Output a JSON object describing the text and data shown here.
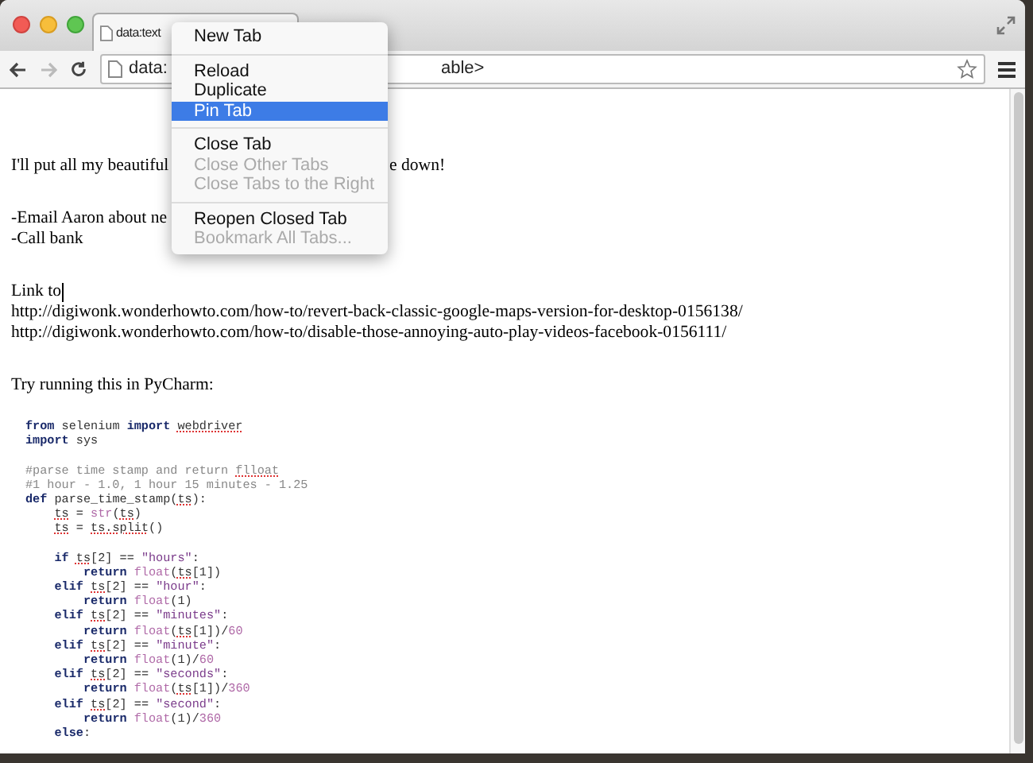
{
  "tab": {
    "title": "data:text"
  },
  "address_bar": {
    "parts": [
      "data:",
      "able>"
    ]
  },
  "page": {
    "lines": [
      {
        "kind": "text",
        "parts": [
          "I'll put all my beautiful",
          "e down!"
        ],
        "gap_before": true
      },
      {
        "kind": "text",
        "parts": [
          "-Email Aaron about ne"
        ],
        "gap_before": true
      },
      {
        "kind": "text",
        "parts": [
          "-Call bank"
        ],
        "gap_before": false
      },
      {
        "kind": "text",
        "parts": [
          "Link to"
        ],
        "gap_before": true,
        "caret": true
      },
      {
        "kind": "text",
        "parts": [
          "http://digiwonk.wonderhowto.com/how-to/revert-back-classic-google-maps-version-for-desktop-0156138/"
        ],
        "gap_before": false
      },
      {
        "kind": "text",
        "parts": [
          "http://digiwonk.wonderhowto.com/how-to/disable-those-annoying-auto-play-videos-facebook-0156111/"
        ],
        "gap_before": false
      },
      {
        "kind": "text",
        "parts": [
          "Try running this in PyCharm:"
        ],
        "gap_before": true
      }
    ]
  },
  "code": [
    {
      "gap_before": false,
      "tokens": [
        {
          "kind": "keyword",
          "text": "from"
        },
        {
          "kind": "plain",
          "text": " selenium "
        },
        {
          "kind": "keyword",
          "text": "import "
        },
        {
          "kind": "flagged",
          "text": "webdriver"
        }
      ]
    },
    {
      "gap_before": false,
      "tokens": [
        {
          "kind": "keyword",
          "text": "import"
        },
        {
          "kind": "plain",
          "text": " sys"
        }
      ]
    },
    {
      "gap_before": true,
      "tokens": [
        {
          "kind": "comment",
          "text": "#parse time stamp and return "
        },
        {
          "kind": "flagged_comment",
          "text": "flloat"
        }
      ]
    },
    {
      "gap_before": false,
      "tokens": [
        {
          "kind": "comment",
          "text": "#1 hour - 1.0, 1 hour 15 minutes - 1.25"
        }
      ]
    },
    {
      "gap_before": false,
      "tokens": [
        {
          "kind": "keyword",
          "text": "def"
        },
        {
          "kind": "plain",
          "text": " parse_time_stamp("
        },
        {
          "kind": "flagged",
          "text": "ts"
        },
        {
          "kind": "plain",
          "text": "):"
        }
      ]
    },
    {
      "gap_before": false,
      "tokens": [
        {
          "kind": "flagged",
          "text": "    ts"
        },
        {
          "kind": "plain",
          "text": " = "
        },
        {
          "kind": "builtin",
          "text": "str"
        },
        {
          "kind": "plain",
          "text": "("
        },
        {
          "kind": "flagged",
          "text": "ts"
        },
        {
          "kind": "plain",
          "text": ")"
        }
      ]
    },
    {
      "gap_before": false,
      "tokens": [
        {
          "kind": "flagged",
          "text": "    ts"
        },
        {
          "kind": "plain",
          "text": " = "
        },
        {
          "kind": "flagged",
          "text": "ts.split"
        },
        {
          "kind": "plain",
          "text": "()"
        }
      ]
    },
    {
      "gap_before": true,
      "tokens": [
        {
          "kind": "keyword",
          "text": "    if "
        },
        {
          "kind": "flagged",
          "text": "ts"
        },
        {
          "kind": "plain",
          "text": "[2] == "
        },
        {
          "kind": "string",
          "text": "\"hours\""
        },
        {
          "kind": "plain",
          "text": ":"
        }
      ]
    },
    {
      "gap_before": false,
      "tokens": [
        {
          "kind": "keyword",
          "text": "        return "
        },
        {
          "kind": "builtin",
          "text": "float"
        },
        {
          "kind": "plain",
          "text": "("
        },
        {
          "kind": "flagged",
          "text": "ts"
        },
        {
          "kind": "plain",
          "text": "[1])"
        }
      ]
    },
    {
      "gap_before": false,
      "tokens": [
        {
          "kind": "keyword",
          "text": "    elif "
        },
        {
          "kind": "flagged",
          "text": "ts"
        },
        {
          "kind": "plain",
          "text": "[2] == "
        },
        {
          "kind": "string",
          "text": "\"hour\""
        },
        {
          "kind": "plain",
          "text": ":"
        }
      ]
    },
    {
      "gap_before": false,
      "tokens": [
        {
          "kind": "keyword",
          "text": "        return "
        },
        {
          "kind": "builtin",
          "text": "float"
        },
        {
          "kind": "plain",
          "text": "(1)"
        }
      ]
    },
    {
      "gap_before": false,
      "tokens": [
        {
          "kind": "keyword",
          "text": "    elif "
        },
        {
          "kind": "flagged",
          "text": "ts"
        },
        {
          "kind": "plain",
          "text": "[2] == "
        },
        {
          "kind": "string",
          "text": "\"minutes\""
        },
        {
          "kind": "plain",
          "text": ":"
        }
      ]
    },
    {
      "gap_before": false,
      "tokens": [
        {
          "kind": "keyword",
          "text": "        return "
        },
        {
          "kind": "builtin",
          "text": "float"
        },
        {
          "kind": "plain",
          "text": "("
        },
        {
          "kind": "flagged",
          "text": "ts"
        },
        {
          "kind": "plain",
          "text": "[1])/"
        },
        {
          "kind": "number",
          "text": "60"
        }
      ]
    },
    {
      "gap_before": false,
      "tokens": [
        {
          "kind": "keyword",
          "text": "    elif "
        },
        {
          "kind": "flagged",
          "text": "ts"
        },
        {
          "kind": "plain",
          "text": "[2] == "
        },
        {
          "kind": "string",
          "text": "\"minute\""
        },
        {
          "kind": "plain",
          "text": ":"
        }
      ]
    },
    {
      "gap_before": false,
      "tokens": [
        {
          "kind": "keyword",
          "text": "        return "
        },
        {
          "kind": "builtin",
          "text": "float"
        },
        {
          "kind": "plain",
          "text": "(1)/"
        },
        {
          "kind": "number",
          "text": "60"
        }
      ]
    },
    {
      "gap_before": false,
      "tokens": [
        {
          "kind": "keyword",
          "text": "    elif "
        },
        {
          "kind": "flagged",
          "text": "ts"
        },
        {
          "kind": "plain",
          "text": "[2] == "
        },
        {
          "kind": "string",
          "text": "\"seconds\""
        },
        {
          "kind": "plain",
          "text": ":"
        }
      ]
    },
    {
      "gap_before": false,
      "tokens": [
        {
          "kind": "keyword",
          "text": "        return "
        },
        {
          "kind": "builtin",
          "text": "float"
        },
        {
          "kind": "plain",
          "text": "("
        },
        {
          "kind": "flagged",
          "text": "ts"
        },
        {
          "kind": "plain",
          "text": "[1])/"
        },
        {
          "kind": "number",
          "text": "360"
        }
      ]
    },
    {
      "gap_before": false,
      "tokens": [
        {
          "kind": "keyword",
          "text": "    elif "
        },
        {
          "kind": "flagged",
          "text": "ts"
        },
        {
          "kind": "plain",
          "text": "[2] == "
        },
        {
          "kind": "string",
          "text": "\"second\""
        },
        {
          "kind": "plain",
          "text": ":"
        }
      ]
    },
    {
      "gap_before": false,
      "tokens": [
        {
          "kind": "keyword",
          "text": "        return "
        },
        {
          "kind": "builtin",
          "text": "float"
        },
        {
          "kind": "plain",
          "text": "(1)/"
        },
        {
          "kind": "number",
          "text": "360"
        }
      ]
    },
    {
      "gap_before": false,
      "tokens": [
        {
          "kind": "keyword",
          "text": "    else"
        },
        {
          "kind": "plain",
          "text": ":"
        }
      ]
    }
  ],
  "context_menu": {
    "groups": [
      [
        {
          "label": "New Tab",
          "disabled": false,
          "selected": false
        }
      ],
      [
        {
          "label": "Reload",
          "disabled": false,
          "selected": false
        },
        {
          "label": "Duplicate",
          "disabled": false,
          "selected": false
        },
        {
          "label": "Pin Tab",
          "disabled": false,
          "selected": true
        }
      ],
      [
        {
          "label": "Close Tab",
          "disabled": false,
          "selected": false
        },
        {
          "label": "Close Other Tabs",
          "disabled": true,
          "selected": false
        },
        {
          "label": "Close Tabs to the Right",
          "disabled": true,
          "selected": false
        }
      ],
      [
        {
          "label": "Reopen Closed Tab",
          "disabled": false,
          "selected": false
        },
        {
          "label": "Bookmark All Tabs...",
          "disabled": true,
          "selected": false
        }
      ]
    ]
  }
}
